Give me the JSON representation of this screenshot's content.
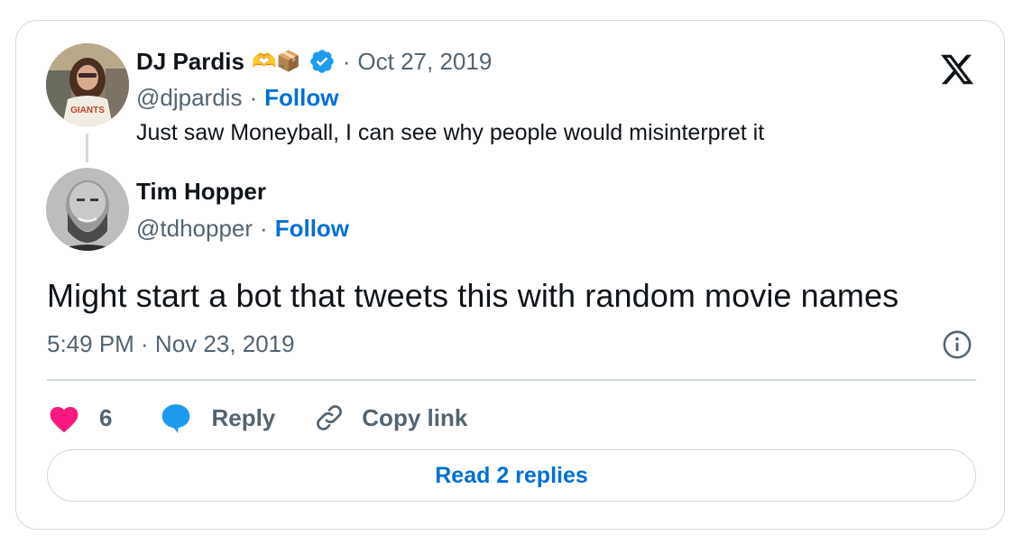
{
  "colors": {
    "follow": "#006fd6",
    "like": "#f91880",
    "reply_bubble": "#1d9bf0",
    "muted": "#536471",
    "border": "#cfd9de"
  },
  "quoted_tweet": {
    "author_name": "DJ Pardis",
    "emojis": "🫶📦",
    "verified_icon": "verified-badge-icon",
    "separator": "·",
    "date": "Oct 27, 2019",
    "handle": "@djpardis",
    "follow_label": "Follow",
    "text": "Just saw Moneyball, I can see why people would misinterpret it"
  },
  "tweet": {
    "author_name": "Tim Hopper",
    "handle": "@tdhopper",
    "separator": "·",
    "follow_label": "Follow",
    "text": "Might start a bot that tweets this with random movie names",
    "timestamp": "5:49 PM · Nov 23, 2019"
  },
  "actions": {
    "like_count": "6",
    "reply_label": "Reply",
    "copy_label": "Copy link"
  },
  "read_replies_label": "Read 2 replies"
}
